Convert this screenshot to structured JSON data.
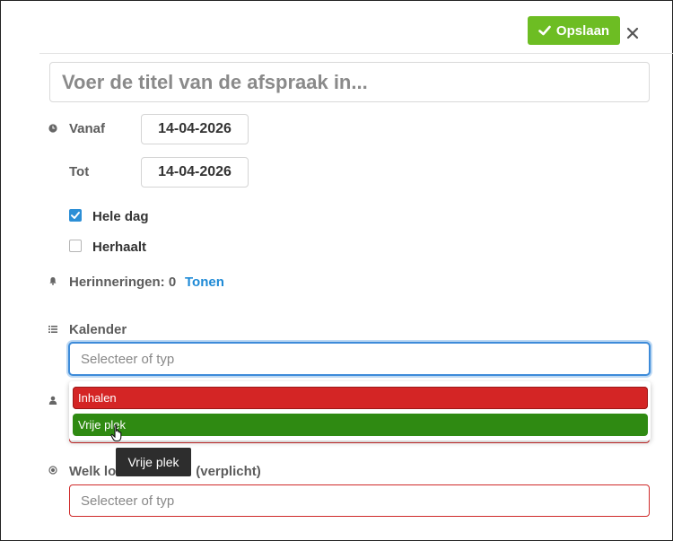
{
  "toolbar": {
    "save_label": "Opslaan"
  },
  "title_input": {
    "placeholder": "Voer de titel van de afspraak in..."
  },
  "from": {
    "label": "Vanaf",
    "date": "14-04-2026"
  },
  "to": {
    "label": "Tot",
    "date": "14-04-2026"
  },
  "all_day": {
    "label": "Hele dag",
    "checked": true
  },
  "repeat": {
    "label": "Herhaalt",
    "checked": false
  },
  "reminders": {
    "label": "Herinneringen: 0",
    "link": "Tonen"
  },
  "calendar": {
    "label": "Kalender",
    "placeholder": "Selecteer of typ",
    "options": [
      {
        "label": "Inhalen",
        "color": "#d42525"
      },
      {
        "label": "Vrije plek",
        "color": "#2f8a12"
      }
    ]
  },
  "tooltip": "Vrije plek",
  "location": {
    "label_visible": "Welk lo",
    "label_tail": "(verplicht)",
    "placeholder": "Selecteer of typ"
  },
  "colors": {
    "accent": "#6dbd23",
    "focus": "#3d8bd9",
    "error": "#cf2a2a",
    "link": "#1e8ad6"
  }
}
